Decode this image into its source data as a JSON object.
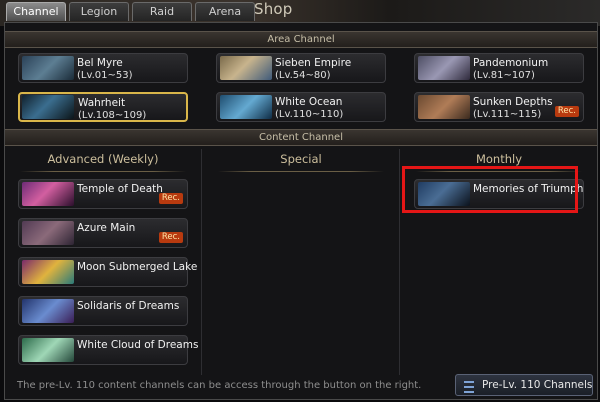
{
  "top": {
    "shop_text": "Shop"
  },
  "tabs": [
    {
      "label": "Channel",
      "active": true
    },
    {
      "label": "Legion",
      "active": false
    },
    {
      "label": "Raid",
      "active": false
    },
    {
      "label": "Arena",
      "active": false
    }
  ],
  "sections": {
    "area": "Area Channel",
    "content": "Content Channel"
  },
  "area_channels": [
    {
      "name": "Bel Myre",
      "level": "(Lv.01~53)",
      "selected": false,
      "rec": ""
    },
    {
      "name": "Sieben Empire",
      "level": "(Lv.54~80)",
      "selected": false,
      "rec": ""
    },
    {
      "name": "Pandemonium",
      "level": "(Lv.81~107)",
      "selected": false,
      "rec": ""
    },
    {
      "name": "Wahrheit",
      "level": "(Lv.108~109)",
      "selected": true,
      "rec": ""
    },
    {
      "name": "White Ocean",
      "level": "(Lv.110~110)",
      "selected": false,
      "rec": ""
    },
    {
      "name": "Sunken Depths",
      "level": "(Lv.111~115)",
      "selected": false,
      "rec": "Rec."
    }
  ],
  "columns": {
    "advanced": "Advanced (Weekly)",
    "special": "Special",
    "monthly": "Monthly"
  },
  "advanced_items": [
    {
      "name": "Temple of Death",
      "rec": "Rec."
    },
    {
      "name": "Azure Main",
      "rec": "Rec."
    },
    {
      "name": "Moon Submerged Lake",
      "rec": ""
    },
    {
      "name": "Solidaris of Dreams",
      "rec": ""
    },
    {
      "name": "White Cloud of Dreams",
      "rec": ""
    }
  ],
  "monthly_items": [
    {
      "name": "Memories of Triumph"
    }
  ],
  "footer": {
    "text": "The pre-Lv. 110 content channels can be access through the button on the right.",
    "button": "Pre-Lv. 110 Channels"
  },
  "colors": {
    "selected_border": "#d9b64a",
    "rec_badge": "#b83a0f",
    "highlight": "#e51616",
    "section_text": "#c7bfa8"
  }
}
